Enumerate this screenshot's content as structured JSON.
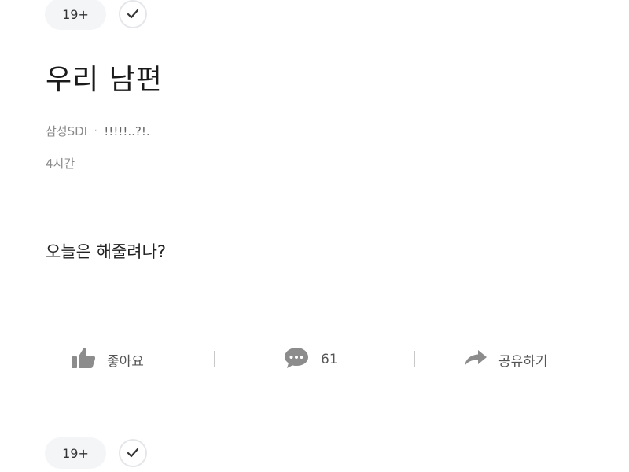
{
  "header_tags": {
    "age_badge": "19+",
    "check_icon": "check-icon"
  },
  "post": {
    "title": "우리 남편",
    "company": "삼성SDI",
    "separator": "·",
    "nickname": "!!!!!..?!.",
    "time": "4시간",
    "body": "오늘은 해줄려나?"
  },
  "actions": {
    "like": {
      "icon": "thumbs-up-icon",
      "label": "좋아요"
    },
    "comment": {
      "icon": "comment-bubble-icon",
      "count": "61"
    },
    "share": {
      "icon": "share-arrow-icon",
      "label": "공유하기"
    }
  },
  "next_post_tags": {
    "age_badge": "19+",
    "check_icon": "check-icon"
  },
  "colors": {
    "badge_bg": "#f4f5f7",
    "icon_gray": "#8c8c8c",
    "text_primary": "#222222",
    "text_secondary": "#8a8a8a"
  }
}
